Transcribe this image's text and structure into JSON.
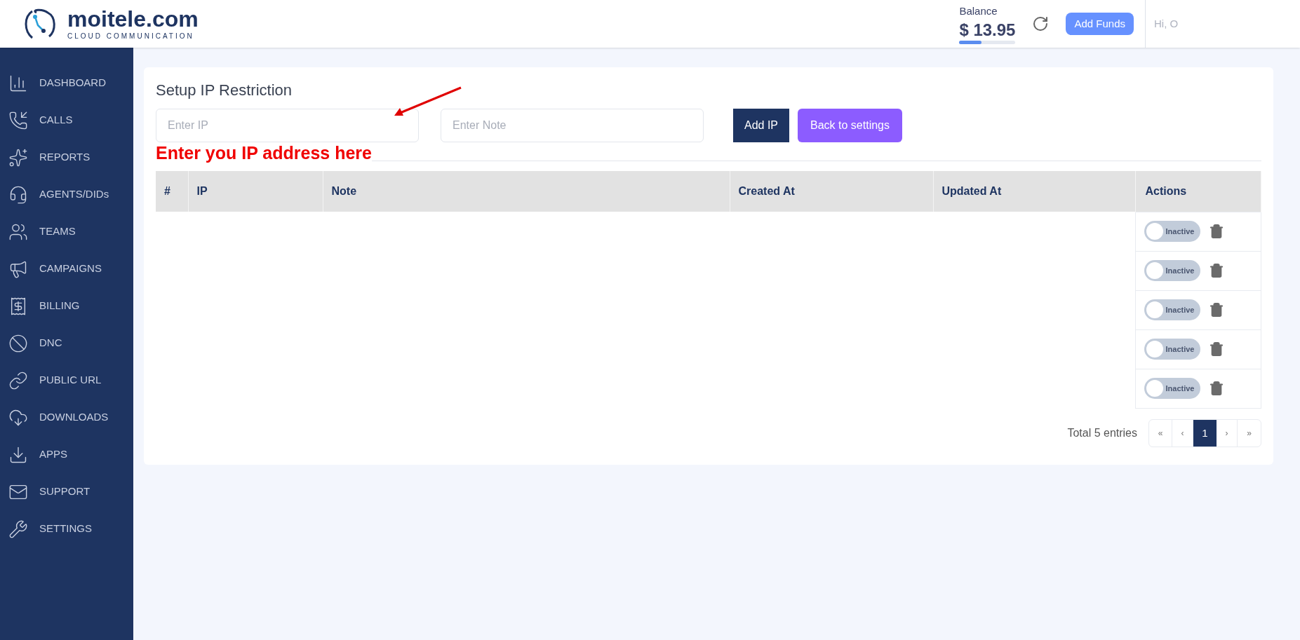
{
  "header": {
    "logo_name": "moitele.com",
    "logo_tagline": "CLOUD COMMUNICATION",
    "balance_label": "Balance",
    "balance": "$ 13.95",
    "balance_bar": {
      "level": 0.4
    },
    "add_funds": "Add Funds",
    "greeting": "Hi, O"
  },
  "sidebar": {
    "items": [
      {
        "label": "DASHBOARD",
        "kind": "dashboard"
      },
      {
        "label": "CALLS",
        "kind": "calls"
      },
      {
        "label": "REPORTS",
        "kind": "reports"
      },
      {
        "label": "AGENTS/DIDs",
        "kind": "agents"
      },
      {
        "label": "TEAMS",
        "kind": "teams"
      },
      {
        "label": "CAMPAIGNS",
        "kind": "campaigns"
      },
      {
        "label": "BILLING",
        "kind": "billing"
      },
      {
        "label": "DNC",
        "kind": "dnc"
      },
      {
        "label": "PUBLIC URL",
        "kind": "link"
      },
      {
        "label": "DOWNLOADS",
        "kind": "downloads"
      },
      {
        "label": "APPS",
        "kind": "apps"
      },
      {
        "label": "SUPPORT",
        "kind": "support"
      },
      {
        "label": "SETTINGS",
        "kind": "settings"
      }
    ]
  },
  "page": {
    "title": "Setup IP Restriction",
    "ip_field": {
      "placeholder": "Enter IP"
    },
    "note_field": {
      "placeholder": "Enter Note"
    },
    "add_button": "Add IP",
    "back_button": "Back to settings",
    "annotation": "Enter you IP address here"
  },
  "table": {
    "columns": [
      "#",
      "IP",
      "Note",
      "Created At",
      "Updated At",
      "Actions"
    ],
    "rows": [
      {
        "status": "Inactive",
        "active": false
      },
      {
        "status": "Inactive",
        "active": false
      },
      {
        "status": "Inactive",
        "active": false
      },
      {
        "status": "Inactive",
        "active": false
      },
      {
        "status": "Inactive",
        "active": false
      }
    ]
  },
  "pagination": {
    "total": "Total 5 entries",
    "first": "«",
    "prev": "‹",
    "pages": [
      {
        "label": "1",
        "selected": true
      }
    ],
    "next": "›",
    "last": "»"
  }
}
